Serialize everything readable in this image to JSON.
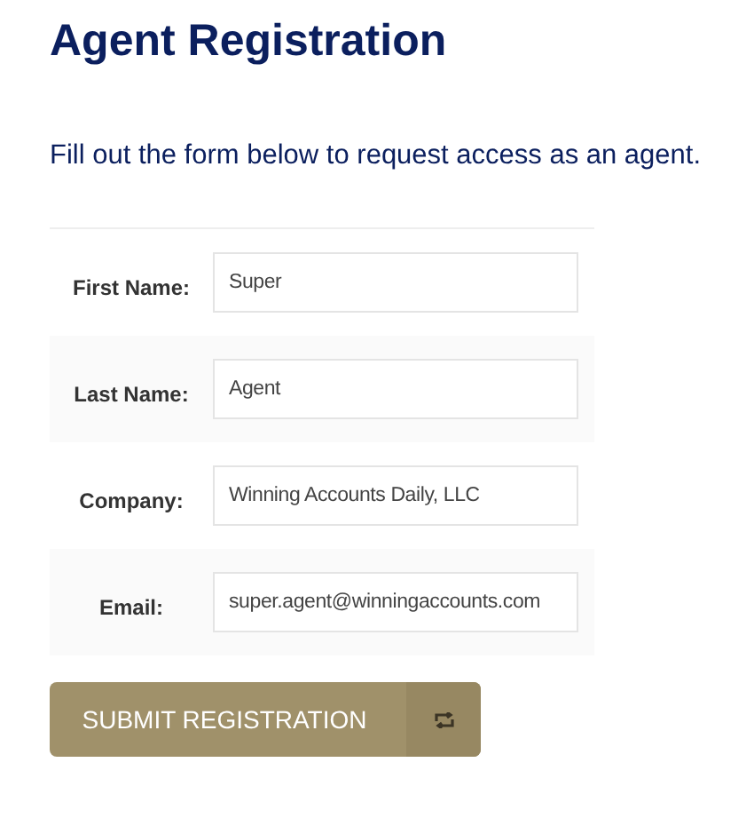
{
  "title": "Agent Registration",
  "intro": "Fill out the form below to request access as an agent.",
  "fields": [
    {
      "label": "First Name:",
      "value": "Super"
    },
    {
      "label": "Last Name:",
      "value": "Agent"
    },
    {
      "label": "Company:",
      "value": "Winning Accounts Daily, LLC"
    },
    {
      "label": "Email:",
      "value": "super.agent@winningaccounts.com"
    }
  ],
  "submit_button": {
    "label": "SUBMIT REGISTRATION"
  }
}
